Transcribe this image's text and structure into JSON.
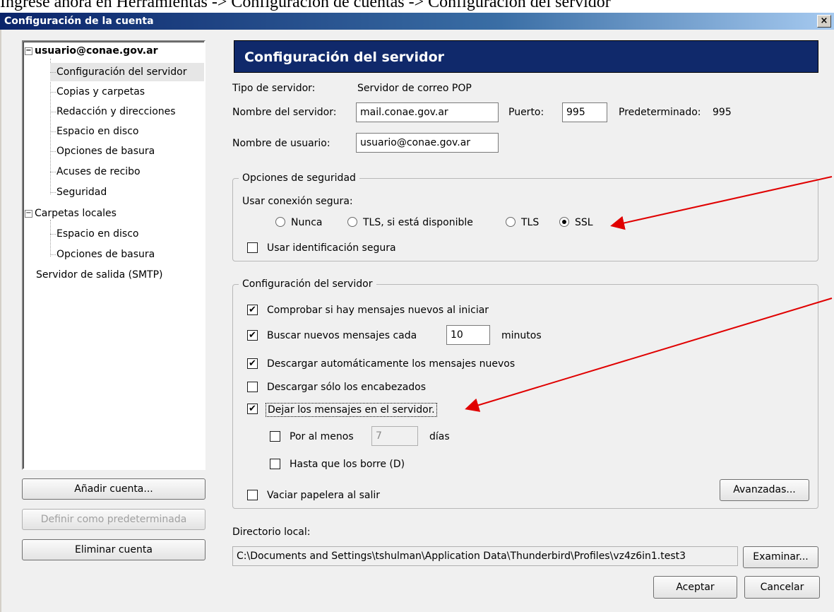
{
  "doc_caption": "Ingrese ahora en Herramientas -> Configuración de cuentas -> Configuración del servidor",
  "window": {
    "title": "Configuración de la cuenta",
    "close_glyph": "×"
  },
  "tree": {
    "items": [
      {
        "label": "usuario@conae.gov.ar",
        "expander": "−"
      },
      {
        "label": "Configuración del servidor"
      },
      {
        "label": "Copias y carpetas"
      },
      {
        "label": "Redacción y direcciones"
      },
      {
        "label": "Espacio en disco"
      },
      {
        "label": "Opciones de basura"
      },
      {
        "label": "Acuses de recibo"
      },
      {
        "label": "Seguridad"
      },
      {
        "label": "Carpetas locales",
        "expander": "−"
      },
      {
        "label": "Espacio en disco"
      },
      {
        "label": "Opciones de basura"
      },
      {
        "label": "Servidor de salida (SMTP)"
      }
    ]
  },
  "left_buttons": {
    "add_account": "Añadir cuenta...",
    "set_default": "Definir como predeterminada",
    "delete_account": "Eliminar cuenta"
  },
  "panel": {
    "header": "Configuración del servidor",
    "server_type_label": "Tipo de servidor:",
    "server_type_value": "Servidor de correo POP",
    "server_name_label": "Nombre del servidor:",
    "server_name_value": "mail.conae.gov.ar",
    "port_label": "Puerto:",
    "port_value": "995",
    "default_label": "Predeterminado:",
    "default_value": "995",
    "username_label": "Nombre de usuario:",
    "username_value": "usuario@conae.gov.ar"
  },
  "security": {
    "legend": "Opciones de seguridad",
    "use_secure_label": "Usar conexión segura:",
    "options": [
      {
        "label": "Nunca",
        "checked": false
      },
      {
        "label": "TLS, si está disponible",
        "checked": false
      },
      {
        "label": "TLS",
        "checked": false
      },
      {
        "label": "SSL",
        "checked": true
      }
    ],
    "secure_auth_label": "Usar identificación segura",
    "secure_auth_checked": false
  },
  "server_settings": {
    "legend": "Configuración del servidor",
    "check_on_start": {
      "label": "Comprobar si hay mensajes nuevos al iniciar",
      "checked": true
    },
    "check_every": {
      "label": "Buscar nuevos mensajes cada",
      "value": "10",
      "unit": "minutos",
      "checked": true
    },
    "auto_download": {
      "label": "Descargar automáticamente los mensajes nuevos",
      "checked": true
    },
    "headers_only": {
      "label": "Descargar sólo los encabezados",
      "checked": false
    },
    "leave_on_server": {
      "label": "Dejar los mensajes en el servidor.",
      "checked": true
    },
    "at_least": {
      "label": "Por al menos",
      "value": "7",
      "unit": "días",
      "checked": false
    },
    "until_deleted": {
      "label": "Hasta que los borre (D)",
      "checked": false
    },
    "empty_trash": {
      "label": "Vaciar papelera al salir",
      "checked": false
    },
    "advanced_button": "Avanzadas..."
  },
  "local_dir": {
    "label": "Directorio local:",
    "value": "C:\\Documents and Settings\\tshulman\\Application Data\\Thunderbird\\Profiles\\vz4z6in1.test3",
    "browse_button": "Examinar..."
  },
  "footer": {
    "ok": "Aceptar",
    "cancel": "Cancelar"
  },
  "check_glyph": "✔",
  "colors": {
    "header_bg": "#10296b",
    "arrow": "#e00000",
    "titlebar": "#0a246a"
  }
}
